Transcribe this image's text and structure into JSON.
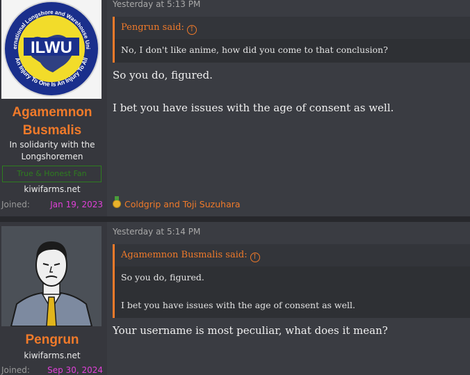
{
  "posts": [
    {
      "author": {
        "name": "Agamemnon Busmalis",
        "title": "In solidarity with the Longshoremen",
        "banner": "True & Honest Fan",
        "site": "kiwifarms.net",
        "joined_label": "Joined:",
        "joined_date": "Jan 19, 2023",
        "avatar": {
          "top_text": "International Longshore and Warehouse Union",
          "center_text": "ILWU",
          "bottom_text": "An Injury To One Is An Injury To All"
        }
      },
      "timestamp": "Yesterday at 5:13 PM",
      "quote": {
        "attribution": "Pengrun said:",
        "icon": "arrow-up-circle-icon",
        "lines": [
          "No, I don't like anime, how did you come to that conclusion?"
        ]
      },
      "body": [
        "So you do, figured.",
        "I bet you have issues with the age of consent as well."
      ],
      "reactions": {
        "icon": "medal-icon",
        "text": "Coldgrip and Toji Suzuhara"
      }
    },
    {
      "author": {
        "name": "Pengrun",
        "site": "kiwifarms.net",
        "joined_label": "Joined:",
        "joined_date": "Sep 30, 2024",
        "avatar": {
          "icon": "man-in-suit-avatar"
        }
      },
      "timestamp": "Yesterday at 5:14 PM",
      "quote": {
        "attribution": "Agamemnon Busmalis said:",
        "icon": "arrow-up-circle-icon",
        "lines": [
          "So you do, figured.",
          "I bet you have issues with the age of consent as well."
        ]
      },
      "body": [
        "Your username is most peculiar, what does it mean?"
      ]
    }
  ],
  "colors": {
    "accent": "#f07a2a",
    "joined_date": "#e040d8",
    "banner": "#2e7d1f"
  }
}
